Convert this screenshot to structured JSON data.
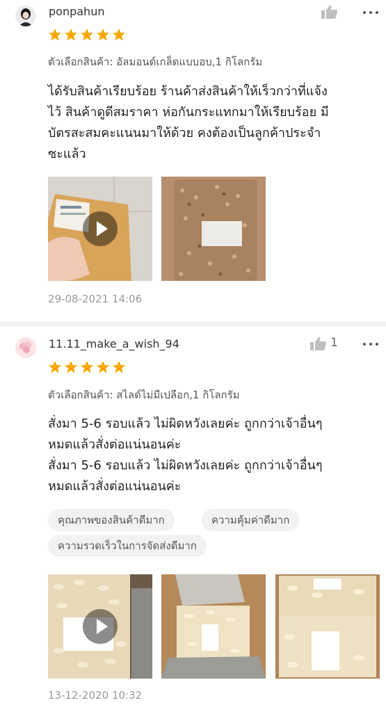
{
  "reviews": [
    {
      "username": "ponpahun",
      "like_count": "",
      "rating": 5,
      "variation": "ตัวเลือกสินค้า: อัลมอนด์เกล็ดแบบอบ,1 กิโลกรัม",
      "text_lines": [
        "ได้รับสินค้าเรียบร้อย ร้านค้าส่งสินค้าให้เร็วกว่าที่แจ้ง",
        "ไว้ สินค้าดูดีสมราคา ห่อกันกระแทกมาให้เรียบร้อย มี",
        "บัตรสะสมคะแนนมาให้ด้วย คงต้องเป็นลูกค้าประจำ",
        "ซะแล้ว"
      ],
      "media": [
        {
          "kind": "video",
          "icon": "play-icon"
        },
        {
          "kind": "image"
        }
      ],
      "date": "29-08-2021 14:06"
    },
    {
      "username": "11.11_make_a_wish_94",
      "like_count": "1",
      "rating": 5,
      "variation": "ตัวเลือกสินค้า: สไลด์ไม่มีเปลือก,1 กิโลกรัม",
      "text_lines": [
        "สั่งมา 5-6 รอบแล้ว ไม่ผิดหวังเลยค่ะ ถูกกว่าเจ้าอื่นๆ",
        "หมดแล้วสั่งต่อแน่นอนค่ะ",
        "สั่งมา 5-6 รอบแล้ว ไม่ผิดหวังเลยค่ะ ถูกกว่าเจ้าอื่นๆ",
        "หมดแล้วสั่งต่อแน่นอนค่ะ"
      ],
      "tags": [
        "คุณภาพของสินค้าดีมาก",
        "ความคุ้มค่าดีมาก",
        "ความรวดเร็วในการจัดส่งดีมาก"
      ],
      "media": [
        {
          "kind": "video",
          "icon": "play-icon"
        },
        {
          "kind": "image"
        },
        {
          "kind": "image"
        }
      ],
      "date": "13-12-2020 10:32"
    }
  ],
  "colors": {
    "star": "#f6a700",
    "text": "#222222",
    "muted": "#999999",
    "chip_bg": "#f2f2f2",
    "divider": "#f2f2f2"
  },
  "icons": {
    "like": "thumbs-up-icon",
    "more": "more-dots-icon",
    "star": "star-icon"
  }
}
